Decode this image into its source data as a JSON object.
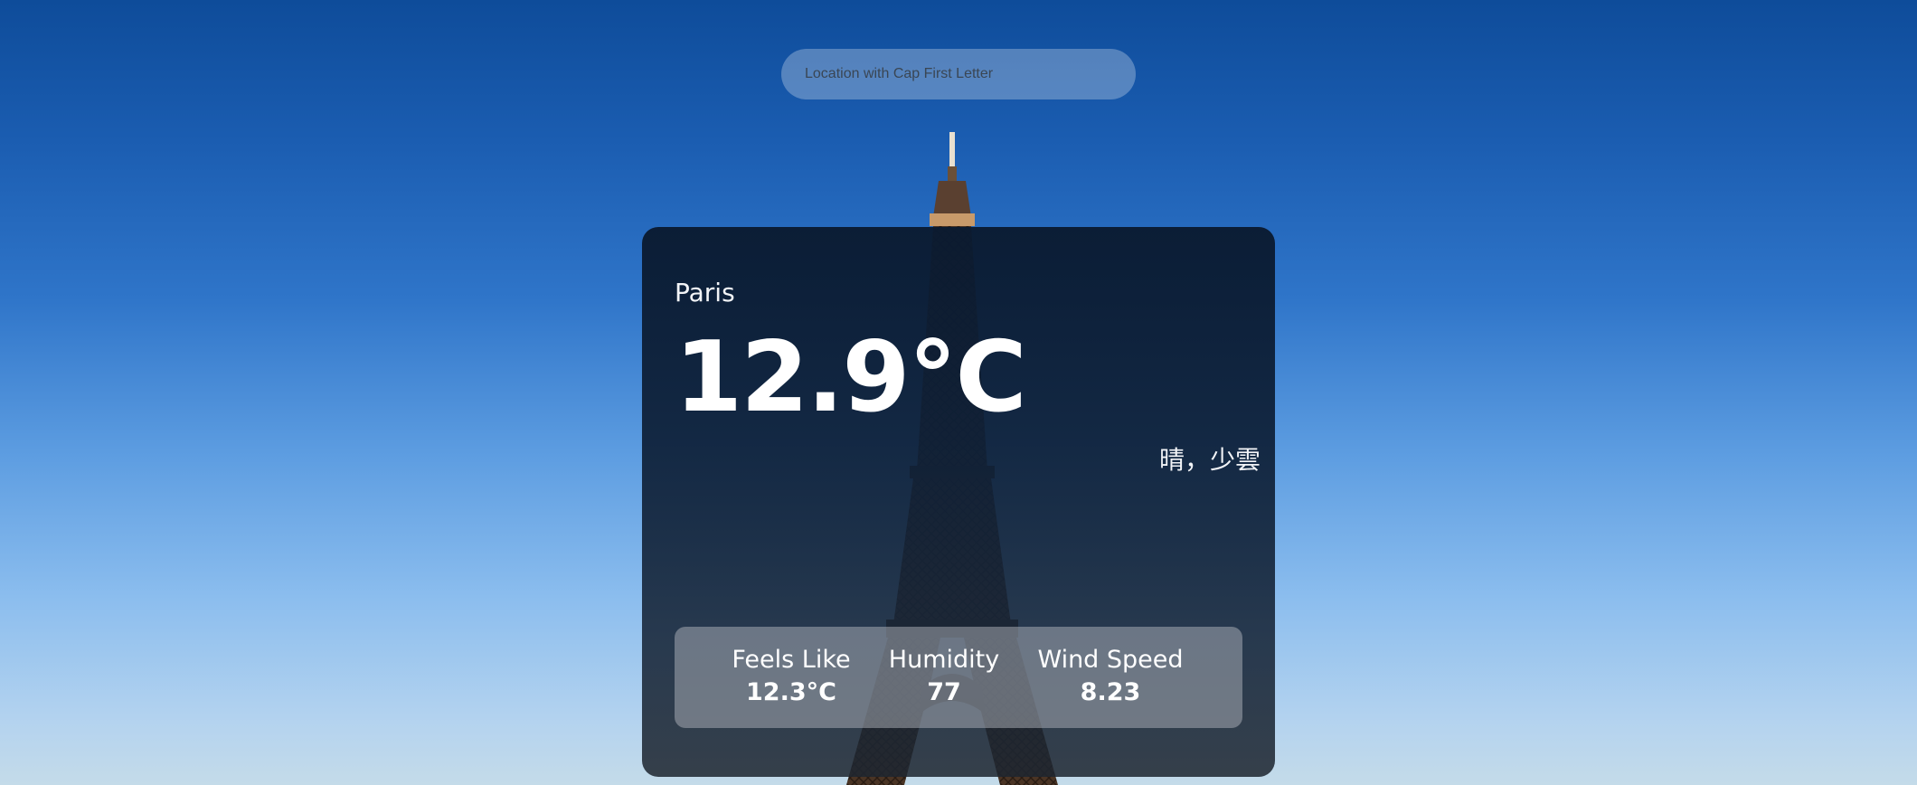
{
  "search": {
    "placeholder": "Location with Cap First Letter"
  },
  "weather": {
    "city": "Paris",
    "temperature": "12.9°C",
    "description": "晴，少雲",
    "stats": [
      {
        "label": "Feels Like",
        "value": "12.3°C"
      },
      {
        "label": "Humidity",
        "value": "77"
      },
      {
        "label": "Wind Speed",
        "value": "8.23"
      }
    ]
  },
  "colors": {
    "sky_top": "#0e4c9a",
    "sky_bottom": "#c4dbe9",
    "card_bg": "#0c1c33",
    "text": "#ffffff"
  }
}
